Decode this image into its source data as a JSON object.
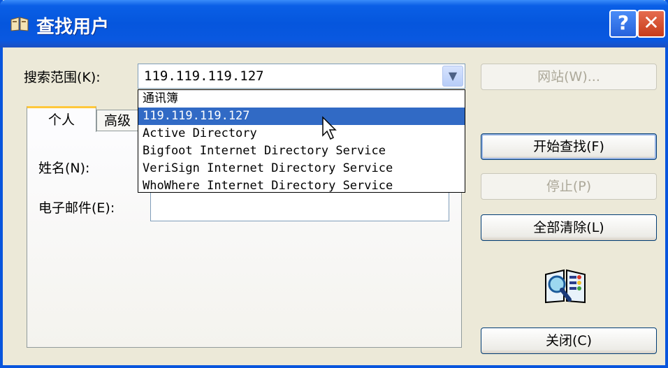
{
  "window": {
    "title": "查找用户",
    "help_icon": "help-icon",
    "close_icon": "close-icon"
  },
  "search_scope": {
    "label": "搜索范围(K):",
    "value": "119.119.119.127",
    "options": [
      "通讯簿",
      "119.119.119.127",
      "Active Directory",
      "Bigfoot Internet Directory Service",
      "VeriSign Internet Directory Service",
      "WhoWhere Internet Directory Service"
    ],
    "selected_index": 1
  },
  "tabs": {
    "personal": "个人",
    "advanced": "高级"
  },
  "form": {
    "name_label": "姓名(N):",
    "email_label": "电子邮件(E):"
  },
  "buttons": {
    "website": "网站(W)...",
    "find_now": "开始查找(F)",
    "stop": "停止(P)",
    "clear_all": "全部清除(L)",
    "close": "关闭(C)"
  },
  "colors": {
    "titlebar": "#0556DD",
    "selection": "#316AC5",
    "tab_accent": "#FFC83C"
  }
}
